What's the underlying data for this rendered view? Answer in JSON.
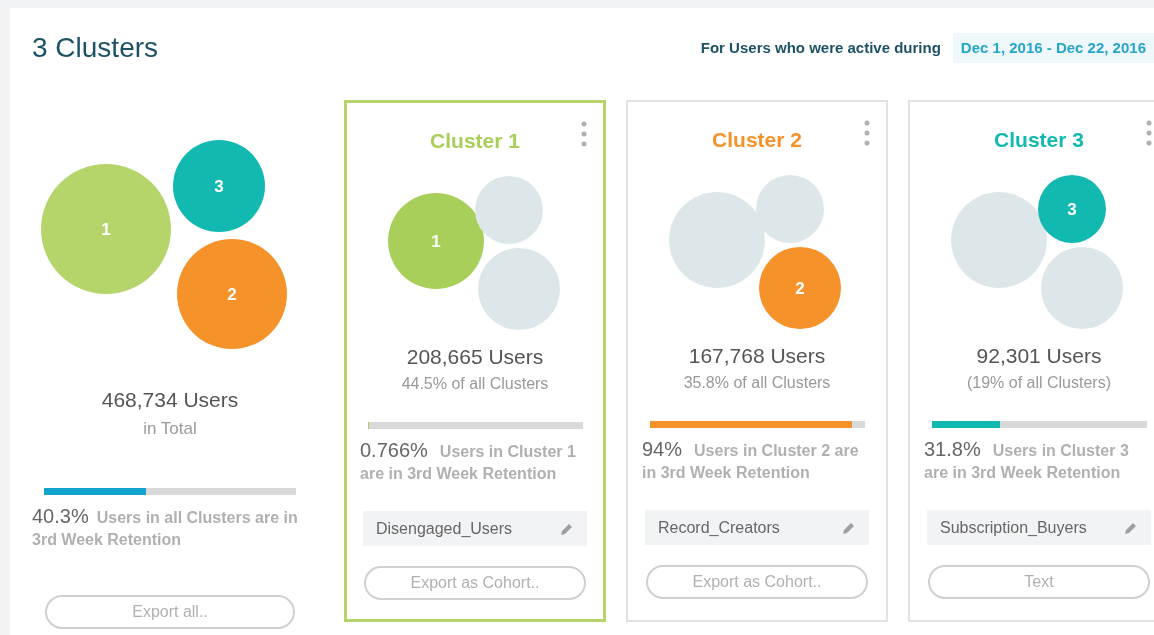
{
  "title": "3 Clusters",
  "date_range": {
    "label": "For Users who were active during",
    "value": "Dec 1, 2016 - Dec 22, 2016"
  },
  "summary": {
    "bubbles": [
      {
        "label": "1",
        "color": "#b5d56a"
      },
      {
        "label": "2",
        "color": "#f5922a"
      },
      {
        "label": "3",
        "color": "#12b9b0"
      }
    ],
    "users": "468,734 Users",
    "subtitle": "in Total",
    "level": 0.403,
    "percent": "40.3%",
    "retention": "Users in all Clusters are in 3rd Week Retention",
    "button": "Export all.."
  },
  "clusters": [
    {
      "name": "Cluster 1",
      "bubble_label": "1",
      "color": "#a8cf5a",
      "selected": true,
      "users": "208,665 Users",
      "share": "44.5% of all Clusters",
      "level": 0.0077,
      "percent": "0.766%",
      "retention": "Users in Cluster 1 are in 3rd Week Retention",
      "tag": "Disengaged_Users",
      "button": "Export as Cohort.."
    },
    {
      "name": "Cluster 2",
      "bubble_label": "2",
      "color": "#f5922a",
      "selected": false,
      "users": "167,768 Users",
      "share": "35.8% of all Clusters",
      "level": 0.94,
      "percent": "94%",
      "retention": "Users in Cluster 2 are in 3rd Week Retention",
      "tag": "Record_Creators",
      "button": "Export as Cohort.."
    },
    {
      "name": "Cluster 3",
      "bubble_label": "3",
      "color": "#12b9b0",
      "selected": false,
      "users": "92,301 Users",
      "share": "(19% of all Clusters)",
      "level": 0.318,
      "percent": "31.8%",
      "retention": "Users in Cluster 3 are in 3rd Week Retention",
      "tag": "Subscription_Buyers",
      "button": "Text"
    }
  ]
}
